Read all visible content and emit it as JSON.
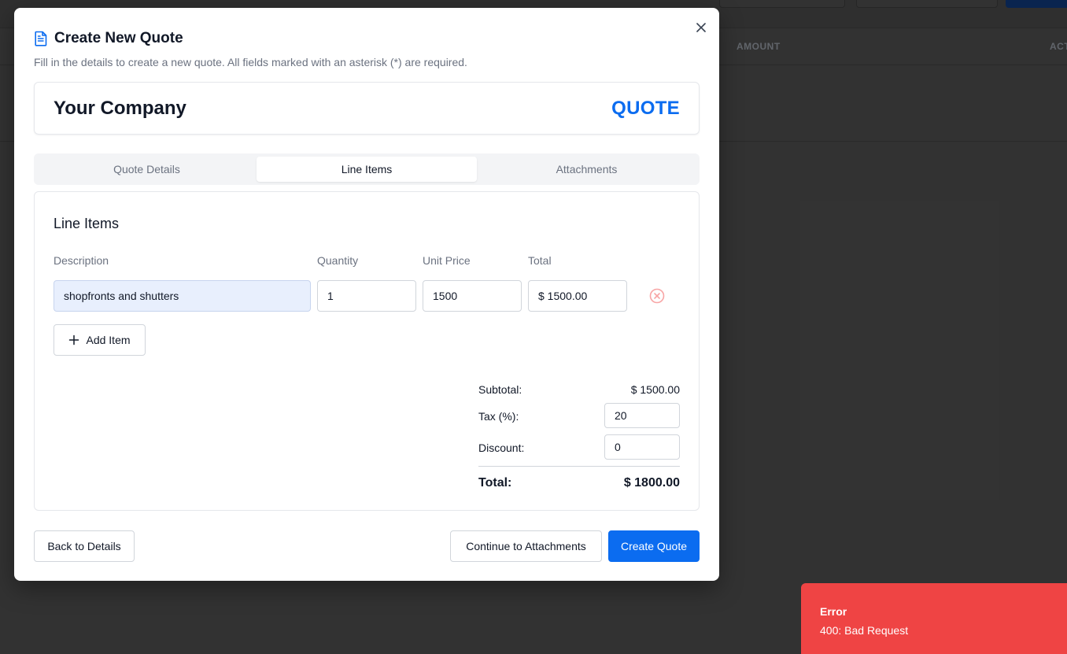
{
  "background": {
    "table_headers": [
      "AMOUNT",
      "ACT"
    ]
  },
  "modal": {
    "title": "Create New Quote",
    "subtitle": "Fill in the details to create a new quote. All fields marked with an asterisk (*) are required.",
    "company_name": "Your Company",
    "document_label": "QUOTE",
    "close_icon": "close-icon",
    "title_icon": "document-icon"
  },
  "tabs": [
    {
      "label": "Quote Details",
      "active": false
    },
    {
      "label": "Line Items",
      "active": true
    },
    {
      "label": "Attachments",
      "active": false
    }
  ],
  "line_items": {
    "heading": "Line Items",
    "columns": [
      "Description",
      "Quantity",
      "Unit Price",
      "Total"
    ],
    "rows": [
      {
        "description": "shopfronts and shutters",
        "quantity": "1",
        "unit_price": "1500",
        "total": "$ 1500.00"
      }
    ],
    "add_item_label": "Add Item"
  },
  "summary": {
    "subtotal_label": "Subtotal:",
    "subtotal_value": "$ 1500.00",
    "tax_label": "Tax (%):",
    "tax_value": "20",
    "discount_label": "Discount:",
    "discount_value": "0",
    "total_label": "Total:",
    "total_value": "$ 1800.00"
  },
  "footer": {
    "back_label": "Back to Details",
    "continue_label": "Continue to Attachments",
    "create_label": "Create Quote"
  },
  "toast": {
    "title": "Error",
    "message": "400: Bad Request"
  },
  "colors": {
    "accent": "#0b6cf0",
    "error": "#ef4444"
  }
}
